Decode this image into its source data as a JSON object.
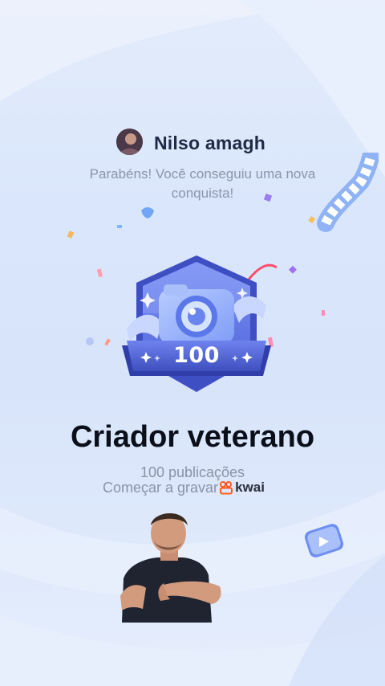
{
  "profile": {
    "username": "Nilso amagh"
  },
  "message": {
    "congrats": "Parabéns! Você conseguiu uma nova conquista!"
  },
  "badge": {
    "number": "100",
    "icon": "camera-badge-icon"
  },
  "achievement": {
    "title": "Criador veterano",
    "subtitle": "100 publicações"
  },
  "cta": {
    "label": "Começar a gravar",
    "brand": "kwai"
  },
  "colors": {
    "background": "#dbe6fb",
    "badge_primary": "#5b6fe6",
    "badge_dark": "#3f4fbf",
    "accent_orange": "#ff5a1f",
    "title": "#0b0f1a",
    "muted_text": "#8a93a8"
  }
}
